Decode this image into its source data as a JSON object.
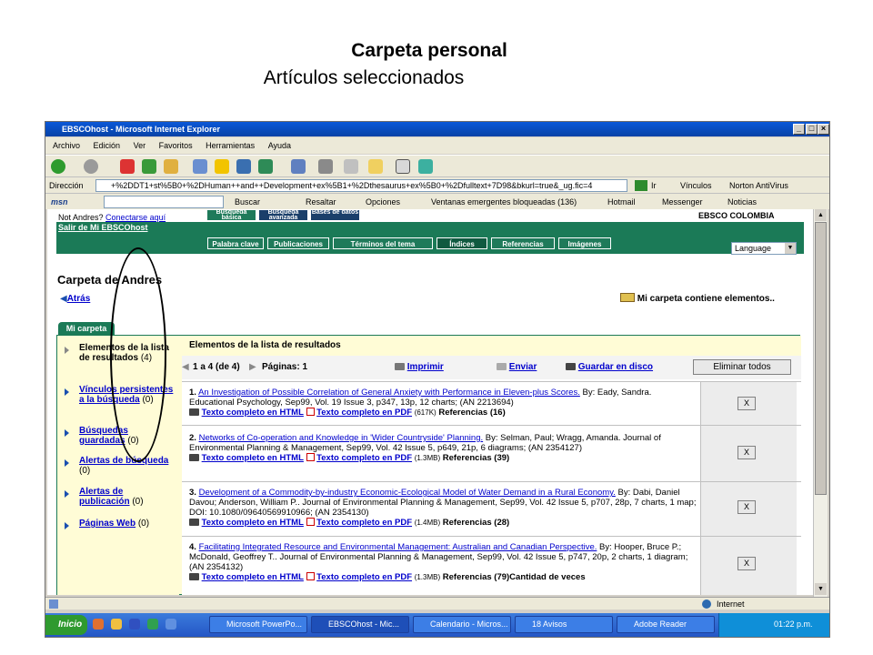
{
  "slide": {
    "title": "Carpeta personal",
    "subtitle": "Artículos seleccionados"
  },
  "window": {
    "title": "EBSCOhost - Microsoft Internet Explorer"
  },
  "menu": [
    "Archivo",
    "Edición",
    "Ver",
    "Favoritos",
    "Herramientas",
    "Ayuda"
  ],
  "address": {
    "label": "Dirección",
    "value": "+%2DDT1+st%5B0+%2DHuman++and++Development+ex%5B1+%2Dthesaurus+ex%5B0+%2Dfulltext+7D98&bkurl=true&_ug.fic=4",
    "go": "Ir",
    "links": "Vínculos",
    "norton": "Norton AntiVirus"
  },
  "msn": {
    "search": "Buscar",
    "highlight": "Resaltar",
    "options": "Opciones",
    "popups": "Ventanas emergentes bloqueadas (136)",
    "hotmail": "Hotmail",
    "messenger": "Messenger",
    "news": "Noticias"
  },
  "page": {
    "not_user": "Not Andres?",
    "login": "Conectarse aquí",
    "logout": "Salir de Mi EBSCOhost",
    "tabs": [
      "Búsqueda básica",
      "Búsqueda avanzada",
      "Bases de datos"
    ],
    "brand": "EBSCO COLOMBIA",
    "language": "Language",
    "subtabs": [
      "Palabra clave",
      "Publicaciones",
      "Términos del tema",
      "Índices",
      "Referencias",
      "Imágenes"
    ],
    "folder_title": "Carpeta de Andres",
    "back": "Atrás",
    "folder_msg": "Mi carpeta contiene elementos..",
    "mytab": "Mi carpeta",
    "left_items": [
      {
        "label": "Elementos de la lista de resultados",
        "count": "(4)"
      },
      {
        "label": "Vínculos persistentes a la búsqueda",
        "count": "(0)"
      },
      {
        "label": "Búsquedas guardadas",
        "count": "(0)"
      },
      {
        "label": "Alertas de búsqueda",
        "count": "(0)"
      },
      {
        "label": "Alertas de publicación",
        "count": "(0)"
      },
      {
        "label": "Páginas Web",
        "count": "(0)"
      }
    ],
    "results_header": "Elementos de la lista de resultados",
    "range": "1 a 4 (de 4)",
    "pages": "Páginas: 1",
    "print": "Imprimir",
    "send": "Enviar",
    "save": "Guardar en disco",
    "remove_all": "Eliminar todos",
    "html_lbl": "Texto completo en HTML",
    "pdf_lbl": "Texto completo en PDF",
    "x": "X",
    "results": [
      {
        "n": "1.",
        "title": "An Investigation of Possible Correlation of General Anxiety with Performance in Eleven-plus Scores.",
        "rest": "By: Eady, Sandra. Educational Psychology, Sep99, Vol. 19 Issue 3, p347, 13p, 12 charts; (AN 2213694)",
        "size": "(617K)",
        "refs": "Referencias (16)"
      },
      {
        "n": "2.",
        "title": "Networks of Co-operation and Knowledge in 'Wider Countryside' Planning.",
        "rest": "By: Selman, Paul; Wragg, Amanda. Journal of Environmental Planning & Management, Sep99, Vol. 42 Issue 5, p649, 21p, 6 diagrams; (AN 2354127)",
        "size": "(1.3MB)",
        "refs": "Referencias (39)"
      },
      {
        "n": "3.",
        "title": "Development of a Commodity-by-industry Economic-Ecological Model of Water Demand in a Rural Economy.",
        "rest": "By: Dabi, Daniel Davou; Anderson, William P.. Journal of Environmental Planning & Management, Sep99, Vol. 42 Issue 5, p707, 28p, 7 charts, 1 map; DOI: 10.1080/09640569910966; (AN 2354130)",
        "size": "(1.4MB)",
        "refs": "Referencias (28)"
      },
      {
        "n": "4.",
        "title": "Facilitating Integrated Resource and Environmental Management: Australian and Canadian Perspective.",
        "rest": "By: Hooper, Bruce P.; McDonald, Geoffrey T.. Journal of Environmental Planning & Management, Sep99, Vol. 42 Issue 5, p747, 20p, 2 charts, 1 diagram; (AN 2354132)",
        "size": "(1.3MB)",
        "refs": "Referencias (79)Cantidad de veces"
      }
    ]
  },
  "status": {
    "zone": "Internet"
  },
  "taskbar": {
    "start": "Inicio",
    "tasks": [
      "Microsoft PowerPo...",
      "EBSCOhost - Mic...",
      "Calendario - Micros...",
      "18 Avisos",
      "Adobe Reader"
    ],
    "clock": "01:22 p.m."
  }
}
